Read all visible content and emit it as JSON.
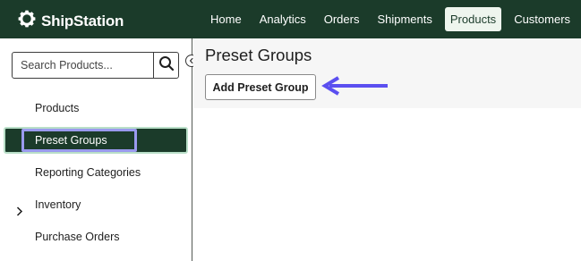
{
  "brand": {
    "name": "ShipStation",
    "logo_icon": "gear-logo-icon"
  },
  "nav": {
    "items": [
      {
        "label": "Home",
        "active": false
      },
      {
        "label": "Analytics",
        "active": false
      },
      {
        "label": "Orders",
        "active": false
      },
      {
        "label": "Shipments",
        "active": false
      },
      {
        "label": "Products",
        "active": true
      },
      {
        "label": "Customers",
        "active": false
      }
    ]
  },
  "sidebar": {
    "search": {
      "placeholder": "Search Products...",
      "value": "",
      "icon": "search-icon"
    },
    "collapse_icon": "chevron-left-circle-icon",
    "items": [
      {
        "label": "Products",
        "selected": false
      },
      {
        "label": "Preset Groups",
        "selected": true
      },
      {
        "label": "Reporting Categories",
        "selected": false
      },
      {
        "label": "Inventory",
        "selected": false,
        "expandable": true
      },
      {
        "label": "Purchase Orders",
        "selected": false
      }
    ]
  },
  "main": {
    "title": "Preset Groups",
    "add_button": "Add Preset Group"
  },
  "colors": {
    "brand_dark_green": "#1b3b2a",
    "active_nav_bg": "#eef5ee",
    "highlight_outline": "#9a9aee",
    "annotation_arrow": "#5b4ff0"
  }
}
